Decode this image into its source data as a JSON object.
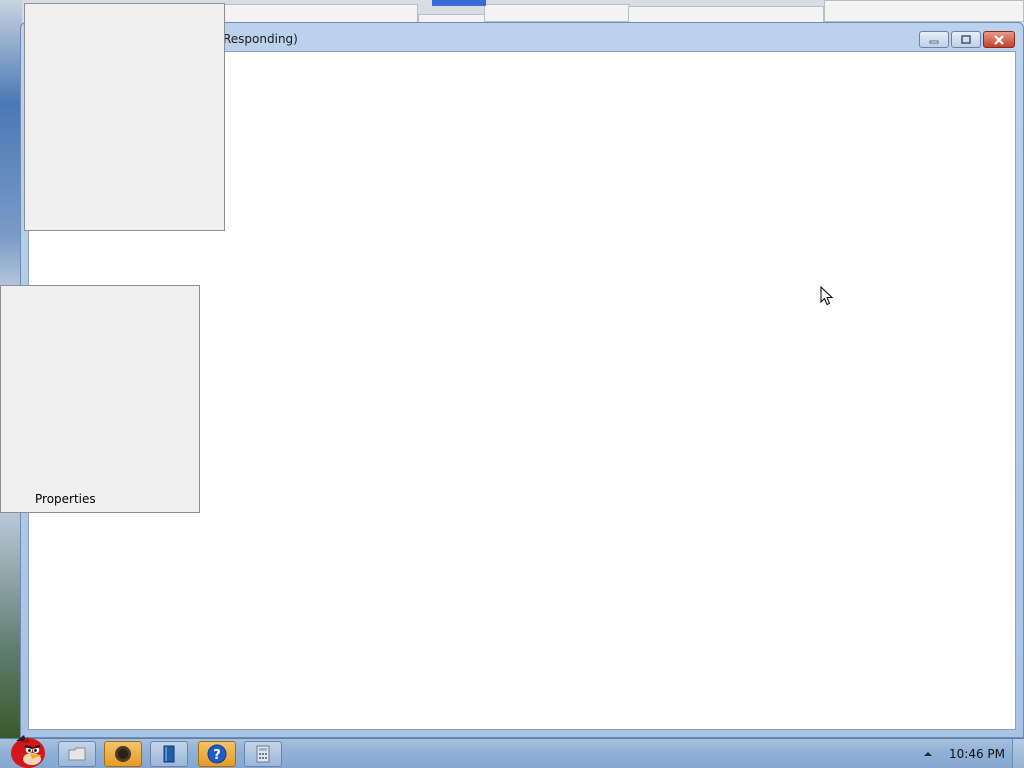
{
  "window": {
    "title": "Responding)",
    "buttons": {
      "minimize_icon": "minimize-icon",
      "maximize_icon": "maximize-icon",
      "close_icon": "close-icon"
    }
  },
  "context_panel": {
    "label": "Properties"
  },
  "taskbar": {
    "start_icon": "angry-bird-start-icon",
    "buttons": [
      {
        "name": "explorer",
        "icon": "folder-icon"
      },
      {
        "name": "recorder",
        "icon": "record-icon",
        "active": true
      },
      {
        "name": "notebook",
        "icon": "book-icon"
      },
      {
        "name": "help",
        "icon": "help-icon",
        "active": true
      },
      {
        "name": "calculator",
        "icon": "calculator-icon"
      }
    ],
    "clock": "10:46 PM"
  },
  "colors": {
    "taskbar": "#8fb0d6",
    "active_button": "#e49c27",
    "window_frame": "#a9c3e3",
    "close_button": "#c4402a"
  }
}
